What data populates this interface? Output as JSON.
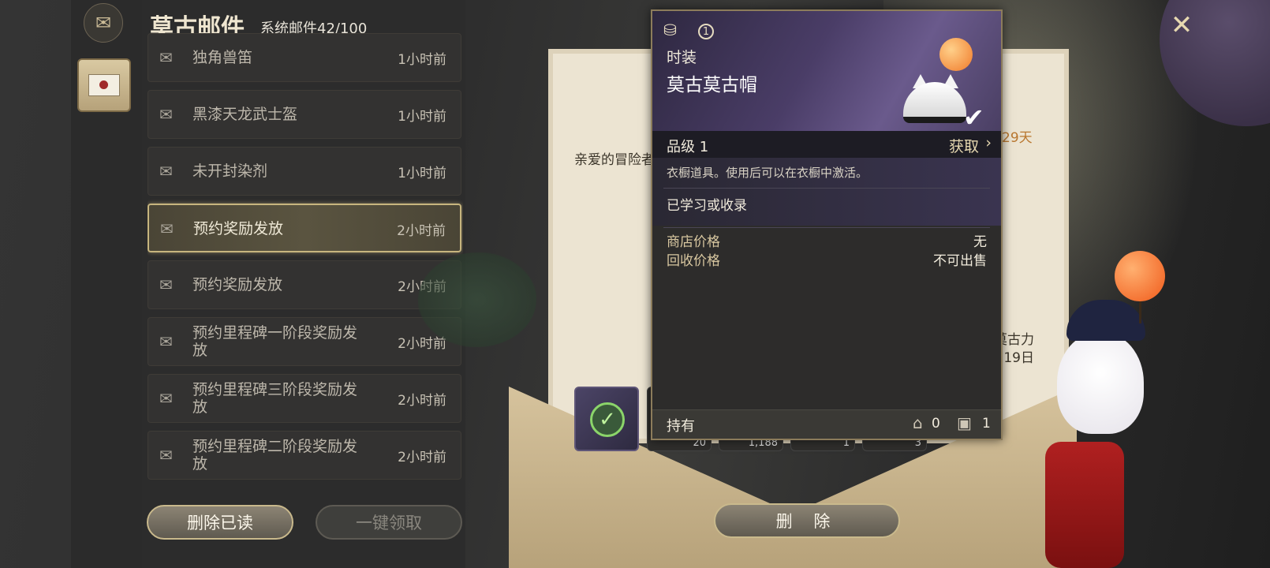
{
  "header": {
    "title": "莫古邮件",
    "subtitle": "系统邮件42/100"
  },
  "mails": [
    {
      "subject": "独角兽笛",
      "time": "1小时前",
      "selected": false
    },
    {
      "subject": "黑漆天龙武士盔",
      "time": "1小时前",
      "selected": false
    },
    {
      "subject": "未开封染剂",
      "time": "1小时前",
      "selected": false
    },
    {
      "subject": "预约奖励发放",
      "time": "2小时前",
      "selected": true
    },
    {
      "subject": "预约奖励发放",
      "time": "2小时前",
      "selected": false
    },
    {
      "subject": "预约里程碑一阶段奖励发放",
      "time": "2小时前",
      "selected": false
    },
    {
      "subject": "预约里程碑三阶段奖励发放",
      "time": "2小时前",
      "selected": false
    },
    {
      "subject": "预约里程碑二阶段奖励发放",
      "time": "2小时前",
      "selected": false
    }
  ],
  "buttons": {
    "delete_read": "删除已读",
    "claim_all": "一键领取",
    "delete": "删 除"
  },
  "letter": {
    "greeting": "亲爱的冒险者",
    "days_left": "29天",
    "signature_line1": "莫古力",
    "signature_line2": "19日",
    "attachment_counts": [
      "20",
      "1,188",
      "1",
      "3"
    ]
  },
  "tooltip": {
    "category": "时装",
    "item_name": "莫古莫古帽",
    "level_badge": "1",
    "grade": "品级 1",
    "acquire": "获取",
    "description": "衣橱道具。使用后可以在衣橱中激活。",
    "learned": "已学习或收录",
    "shop_price_label": "商店价格",
    "shop_price_value": "无",
    "sell_price_label": "回收价格",
    "sell_price_value": "不可出售",
    "owned_label": "持有",
    "owned_house": "0",
    "owned_bag": "1"
  },
  "icons": {
    "mail": "envelope-icon",
    "close": "close-icon",
    "acquire": "chevron-right-icon",
    "house": "house-icon",
    "bag": "bag-icon"
  }
}
